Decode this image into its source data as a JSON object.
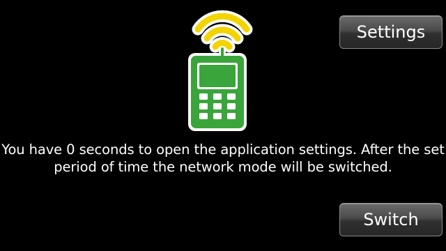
{
  "dialog": {
    "message": "You have 0 seconds to open the application settings. After the set period of time the network mode will be switched.",
    "settings_label": "Settings",
    "switch_label": "Switch",
    "icon": "phone-signal-icon"
  },
  "colors": {
    "background": "#000000",
    "phone_green": "#3aa53a",
    "signal_yellow": "#f2d400",
    "text": "#ffffff"
  }
}
